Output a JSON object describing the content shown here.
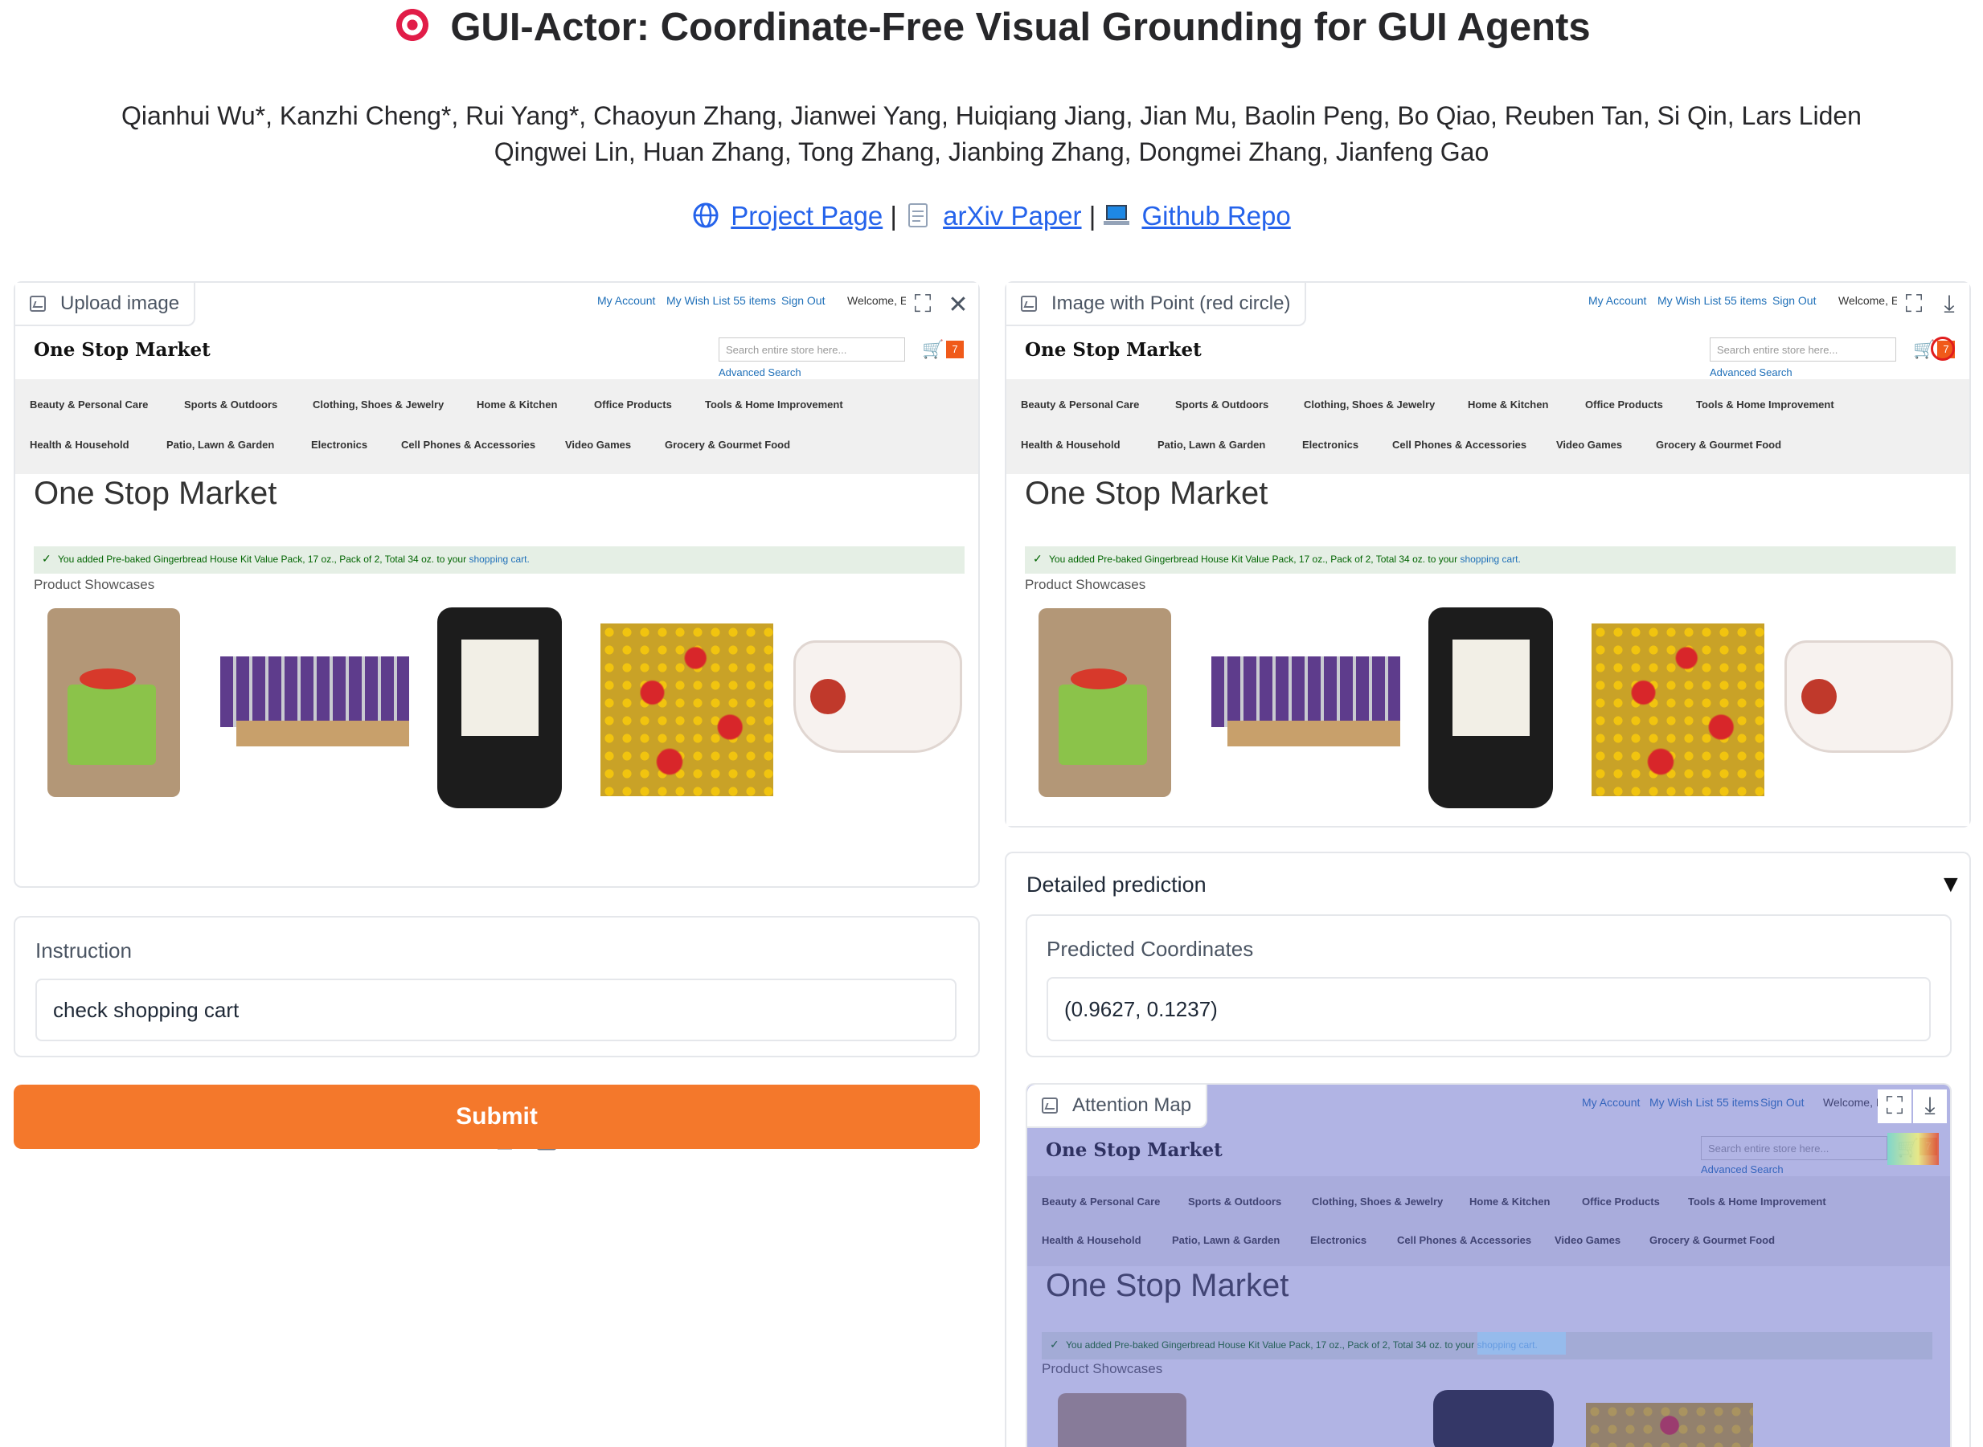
{
  "header": {
    "title": "GUI-Actor: Coordinate-Free Visual Grounding for GUI Agents",
    "authors_line1": "Qianhui Wu*, Kanzhi Cheng*, Rui Yang*, Chaoyun Zhang, Jianwei Yang, Huiqiang Jiang, Jian Mu, Baolin Peng, Bo Qiao, Reuben Tan, Si Qin, Lars Liden",
    "authors_line2": "Qingwei Lin, Huan Zhang, Tong Zhang, Jianbing Zhang, Dongmei Zhang, Jianfeng Gao",
    "links": {
      "project": "Project Page",
      "arxiv": "arXiv Paper",
      "github": "Github Repo",
      "separator": "|"
    }
  },
  "upload_panel": {
    "label": "Upload image"
  },
  "output_panel": {
    "label": "Image with Point (red circle)"
  },
  "attention_panel": {
    "label": "Attention Map"
  },
  "shop": {
    "my_account": "My Account",
    "wishlist": "My Wish List 55 items",
    "sign_out": "Sign Out",
    "welcome": "Welcome, E",
    "logo": "One Stop Market",
    "search_placeholder": "Search entire store here...",
    "advanced_search": "Advanced Search",
    "cart_count": "7",
    "nav_row1": [
      "Beauty & Personal Care",
      "Sports & Outdoors",
      "Clothing, Shoes & Jewelry",
      "Home & Kitchen",
      "Office Products",
      "Tools & Home Improvement"
    ],
    "nav_row2": [
      "Health & Household",
      "Patio, Lawn & Garden",
      "Electronics",
      "Cell Phones & Accessories",
      "Video Games",
      "Grocery & Gourmet Food"
    ],
    "page_title": "One Stop Market",
    "message": "You added Pre-baked Gingerbread House Kit Value Pack, 17 oz., Pack of 2, Total 34 oz. to your",
    "message_link": "shopping cart.",
    "showcase": "Product Showcases"
  },
  "instruction": {
    "label": "Instruction",
    "value": "check shopping cart"
  },
  "submit_label": "Submit",
  "prediction": {
    "accordion_label": "Detailed prediction",
    "coords_label": "Predicted Coordinates",
    "coords_value": "(0.9627, 0.1237)"
  },
  "colors": {
    "submit": "#f4782b",
    "link": "#2563eb",
    "attention_tint": "#5258c4"
  }
}
